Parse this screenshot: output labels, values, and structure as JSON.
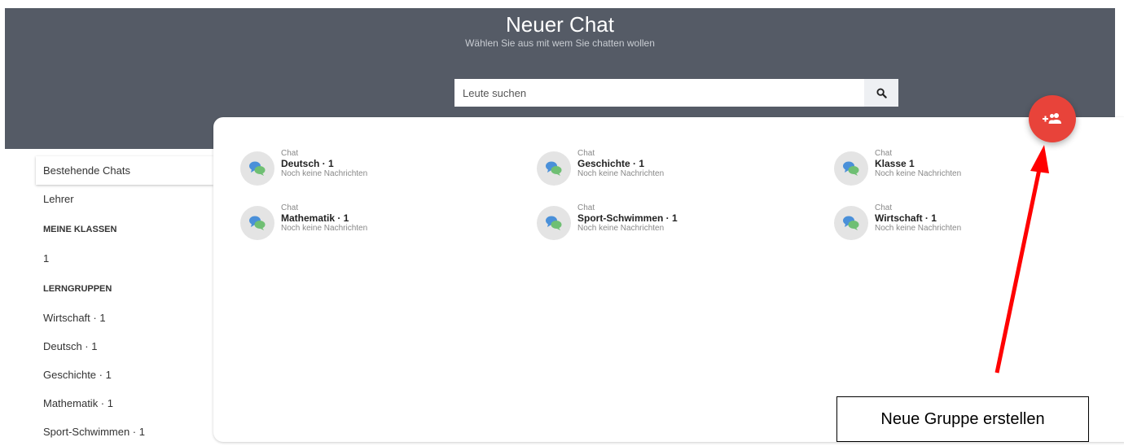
{
  "header": {
    "title": "Neuer Chat",
    "subtitle": "Wählen Sie aus mit wem Sie chatten wollen"
  },
  "search": {
    "placeholder": "Leute suchen",
    "icon": "search-icon"
  },
  "sidebar": {
    "items": [
      {
        "label": "Bestehende Chats",
        "active": true
      },
      {
        "label": "Lehrer"
      }
    ],
    "sections": [
      {
        "heading": "MEINE KLASSEN",
        "items": [
          "1"
        ]
      },
      {
        "heading": "LERNGRUPPEN",
        "items": [
          "Wirtschaft · 1",
          "Deutsch · 1",
          "Geschichte · 1",
          "Mathematik · 1",
          "Sport-Schwimmen · 1"
        ]
      }
    ]
  },
  "chats": [
    {
      "type": "Chat",
      "name": "Deutsch · 1",
      "last_message": "Noch keine Nachrichten"
    },
    {
      "type": "Chat",
      "name": "Geschichte · 1",
      "last_message": "Noch keine Nachrichten"
    },
    {
      "type": "Chat",
      "name": "Klasse 1",
      "last_message": "Noch keine Nachrichten"
    },
    {
      "type": "Chat",
      "name": "Mathematik · 1",
      "last_message": "Noch keine Nachrichten"
    },
    {
      "type": "Chat",
      "name": "Sport-Schwimmen · 1",
      "last_message": "Noch keine Nachrichten"
    },
    {
      "type": "Chat",
      "name": "Wirtschaft · 1",
      "last_message": "Noch keine Nachrichten"
    }
  ],
  "fab": {
    "icon": "group-add-icon",
    "color": "#e8433a"
  },
  "annotation": {
    "text": "Neue Gruppe erstellen",
    "arrow_color": "#ff0000"
  },
  "colors": {
    "header_bg": "#555b66",
    "accent": "#e8433a"
  }
}
